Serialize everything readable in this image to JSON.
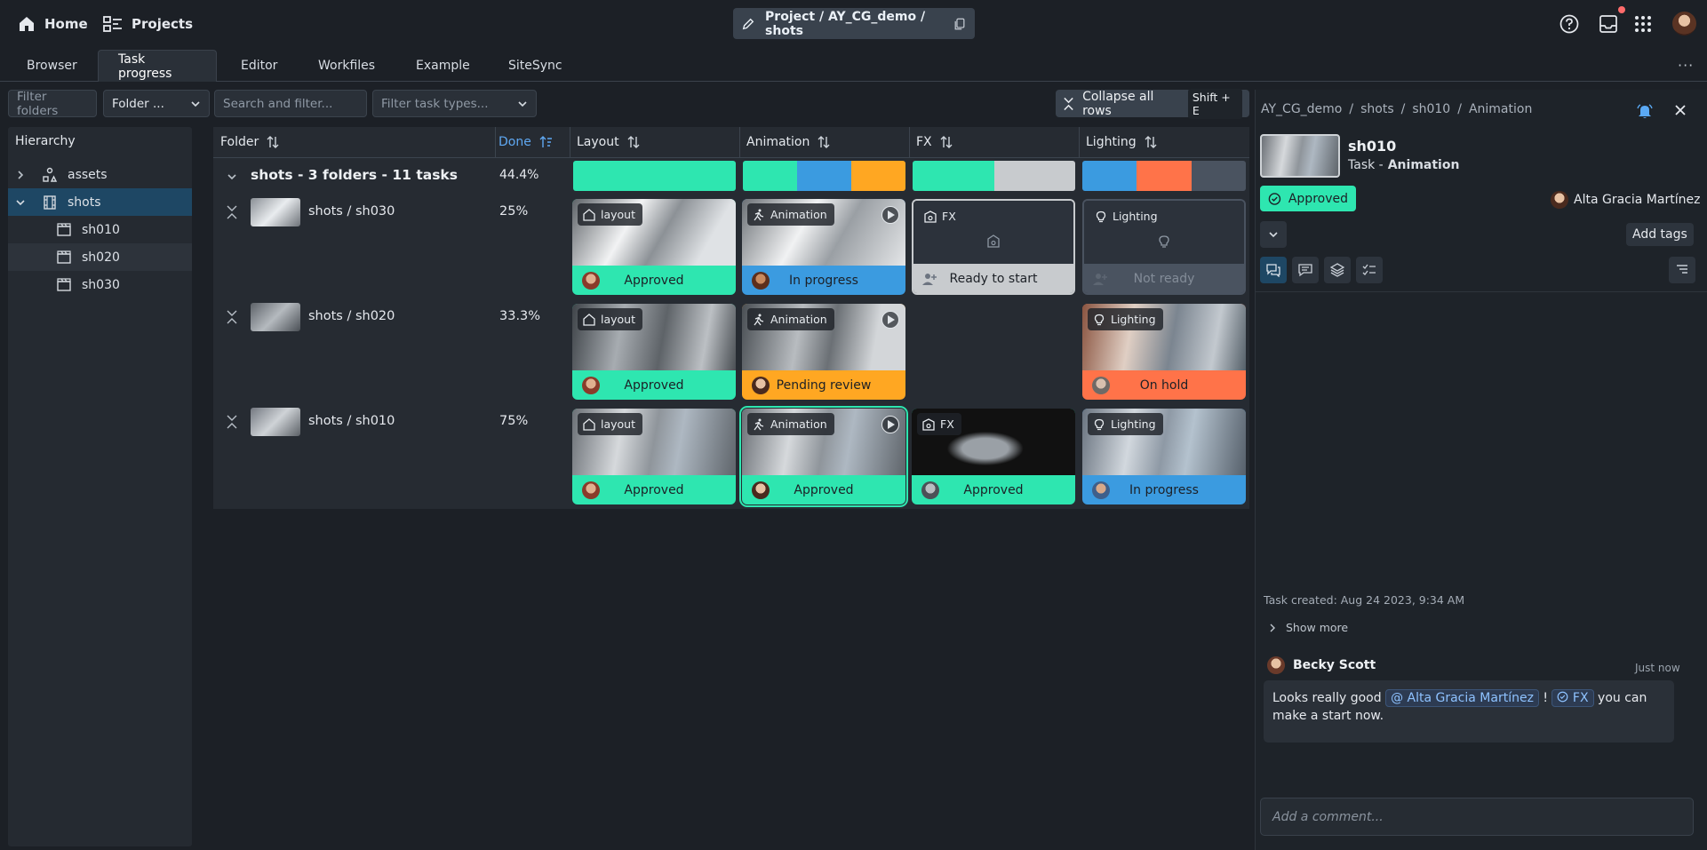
{
  "topbar": {
    "home_label": "Home",
    "projects_label": "Projects",
    "breadcrumb": "Project / AY_CG_demo / shots"
  },
  "tabs": [
    "Browser",
    "Task progress",
    "Editor",
    "Workfiles",
    "Example",
    "SiteSync"
  ],
  "active_tab": "Task progress",
  "filters": {
    "filter_folders_placeholder": "Filter folders",
    "folder_select": "Folder ...",
    "search_placeholder": "Search and filter...",
    "task_types_placeholder": "Filter task types...",
    "collapse_label": "Collapse all rows",
    "collapse_shortcut": "Shift + E"
  },
  "hierarchy": {
    "title": "Hierarchy",
    "items": [
      {
        "label": "assets",
        "level": 0,
        "selected": false
      },
      {
        "label": "shots",
        "level": 0,
        "selected": true
      },
      {
        "label": "sh010",
        "level": 1,
        "selected": false
      },
      {
        "label": "sh020",
        "level": 1,
        "selected": false
      },
      {
        "label": "sh030",
        "level": 1,
        "selected": false
      }
    ]
  },
  "grid": {
    "col_folder": "Folder",
    "col_done": "Done",
    "columns": [
      "Layout",
      "Animation",
      "FX",
      "Lighting"
    ],
    "group_label": "shots - 3 folders - 11 tasks",
    "group_done": "44.4%",
    "rows": [
      {
        "folder": "shots / sh030",
        "done": "25%",
        "tasks": [
          {
            "tag": "layout",
            "status": "Approved"
          },
          {
            "tag": "Animation",
            "status": "In progress"
          },
          {
            "tag": "FX",
            "status": "Ready to start"
          },
          {
            "tag": "Lighting",
            "status": "Not ready"
          }
        ]
      },
      {
        "folder": "shots / sh020",
        "done": "33.3%",
        "tasks": [
          {
            "tag": "layout",
            "status": "Approved"
          },
          {
            "tag": "Animation",
            "status": "Pending review"
          },
          null,
          {
            "tag": "Lighting",
            "status": "On hold"
          }
        ]
      },
      {
        "folder": "shots / sh010",
        "done": "75%",
        "tasks": [
          {
            "tag": "layout",
            "status": "Approved"
          },
          {
            "tag": "Animation",
            "status": "Approved"
          },
          {
            "tag": "FX",
            "status": "Approved"
          },
          {
            "tag": "Lighting",
            "status": "In progress"
          }
        ]
      }
    ]
  },
  "status_colors": {
    "Approved": "#2ee6b0",
    "In progress": "#3b9be0",
    "Ready to start": "#c8cbce",
    "Not ready": "#4a5360",
    "Pending review": "#ffa722",
    "On hold": "#ff7349"
  },
  "panel": {
    "breadcrumb": [
      "AY_CG_demo",
      "shots",
      "sh010",
      "Animation"
    ],
    "title": "sh010",
    "subtitle_prefix": "Task -",
    "subtitle_task": "Animation",
    "status": "Approved",
    "assignee": "Alta Gracia Martínez",
    "add_tags": "Add tags",
    "task_created": "Task created: Aug 24 2023, 9:34 AM",
    "show_more": "Show more",
    "comment": {
      "author": "Becky Scott",
      "time": "Just now",
      "text_1": "Looks really good",
      "mention_user": "Alta Gracia Martínez",
      "text_2": "!",
      "mention_task": "FX",
      "text_3": "you can make a",
      "text_4": "start now."
    },
    "comment_placeholder": "Add a comment..."
  }
}
